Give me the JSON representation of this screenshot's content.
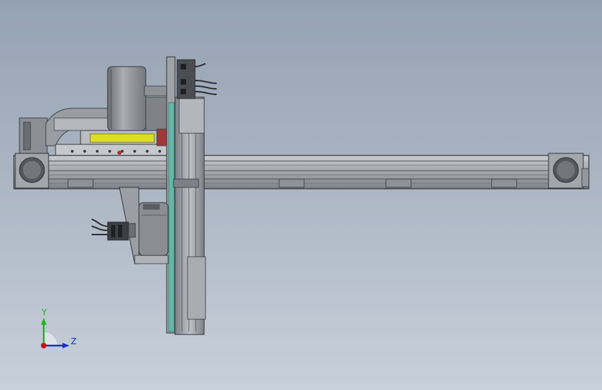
{
  "triad": {
    "y_label": "Y",
    "z_label": "Z",
    "colors": {
      "y": "#1fb41f",
      "z": "#1a2fc8",
      "origin": "#d01010"
    }
  },
  "colors": {
    "background_top": "#95a2b3",
    "background_bottom": "#c8d0da",
    "rail": "#a7aaaf",
    "steel_dark": "#5c5f66",
    "steel_mid": "#8b8f96",
    "accent_yellow": "#dede2a",
    "accent_teal": "#5fb8a8",
    "accent_red": "#b03030"
  },
  "icons": [
    "coordinate-triad-icon"
  ]
}
